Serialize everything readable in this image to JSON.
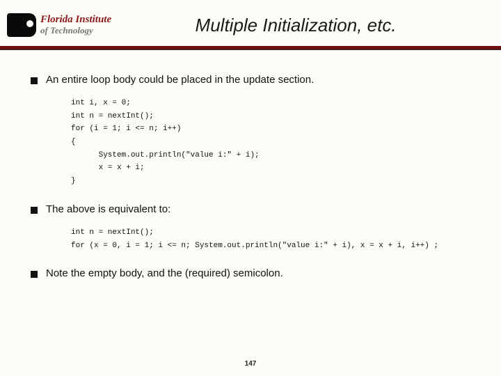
{
  "logo": {
    "line1": "Florida Institute",
    "line2": "of Technology"
  },
  "title": "Multiple Initialization, etc.",
  "bullets": {
    "b1": "An entire loop body could be placed in the update section.",
    "b2": "The above is equivalent to:",
    "b3": "Note the empty body, and the (required) semicolon."
  },
  "code": {
    "block1": "int i, x = 0;\nint n = nextInt();\nfor (i = 1; i <= n; i++)\n{\n      System.out.println(\"value i:\" + i);\n      x = x + i;\n}",
    "block2": "int n = nextInt();\nfor (x = 0, i = 1; i <= n; System.out.println(\"value i:\" + i), x = x + i, i++) ;"
  },
  "page_number": "147"
}
